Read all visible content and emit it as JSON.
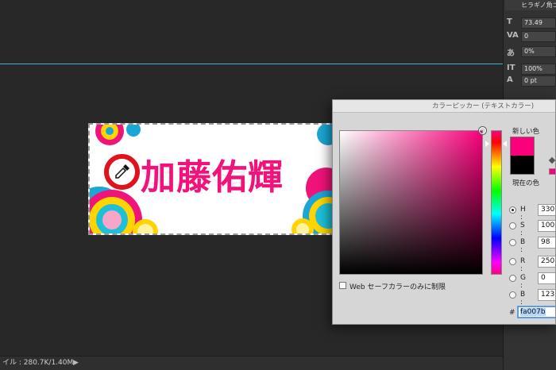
{
  "document": {
    "banner_text": "加藤佑輝"
  },
  "status_bar": {
    "text": "イル : 280.7K/1.40M"
  },
  "character_panel": {
    "font_name": "ヒラギノ角ゴ",
    "rows": [
      {
        "icon": "T",
        "value": "73.49"
      },
      {
        "icon": "VA",
        "value": "0"
      },
      {
        "icon": "あ",
        "value": "0%"
      },
      {
        "icon": "IT",
        "value": "100%"
      },
      {
        "icon": "A",
        "value": "0 pt"
      }
    ]
  },
  "color_picker": {
    "title": "カラーピッカー (テキストカラー)",
    "new_label": "新しい色",
    "current_label": "現在の色",
    "new_color": "#fa007b",
    "current_color": "#000000",
    "websafe_label": "Web セーフカラーのみに制限",
    "hex_symbol": "#",
    "hex_value": "fa007b",
    "fields": [
      {
        "label": "H :",
        "value": "330",
        "selected": true
      },
      {
        "label": "S :",
        "value": "100",
        "selected": false
      },
      {
        "label": "B :",
        "value": "98",
        "selected": false
      },
      {
        "label": "R :",
        "value": "250",
        "selected": false
      },
      {
        "label": "G :",
        "value": "0",
        "selected": false
      },
      {
        "label": "B :",
        "value": "123",
        "selected": false
      }
    ]
  },
  "colors": {
    "accent_pink": "#f0137a",
    "guide_cyan": "#3fb5cf",
    "eyedropper_ring": "#e0131d"
  }
}
